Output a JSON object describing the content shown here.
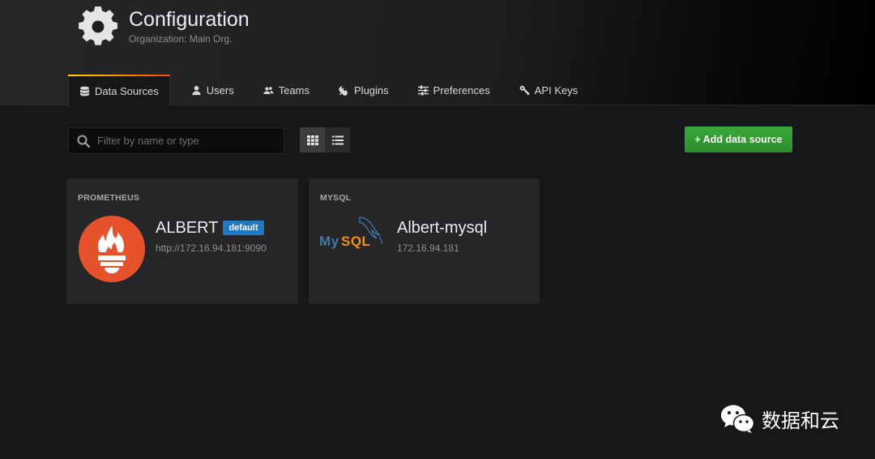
{
  "header": {
    "title": "Configuration",
    "subtitle": "Organization: Main Org.",
    "icon": "gear-icon"
  },
  "tabs": [
    {
      "label": "Data Sources",
      "icon": "database-icon",
      "active": true
    },
    {
      "label": "Users",
      "icon": "user-icon",
      "active": false
    },
    {
      "label": "Teams",
      "icon": "users-icon",
      "active": false
    },
    {
      "label": "Plugins",
      "icon": "plug-icon",
      "active": false
    },
    {
      "label": "Preferences",
      "icon": "sliders-icon",
      "active": false
    },
    {
      "label": "API Keys",
      "icon": "key-icon",
      "active": false
    }
  ],
  "toolbar": {
    "search_placeholder": "Filter by name or type",
    "add_label": "+ Add data source",
    "view_mode": "grid"
  },
  "datasources": [
    {
      "type": "PROMETHEUS",
      "name": "ALBERT",
      "badge": "default",
      "url": "http://172.16.94.181:9090",
      "logo": "prometheus-logo"
    },
    {
      "type": "MYSQL",
      "name": "Albert-mysql",
      "url": "172.16.94.181",
      "logo": "mysql-logo",
      "logo_text": "MySQL"
    }
  ],
  "watermark": {
    "text": "数据和云",
    "icon": "wechat-icon"
  },
  "colors": {
    "background": "#161719",
    "card": "#262628",
    "accent_green": "#2f9a2f",
    "badge_blue": "#1f78c1",
    "prometheus_orange": "#e6522c"
  }
}
